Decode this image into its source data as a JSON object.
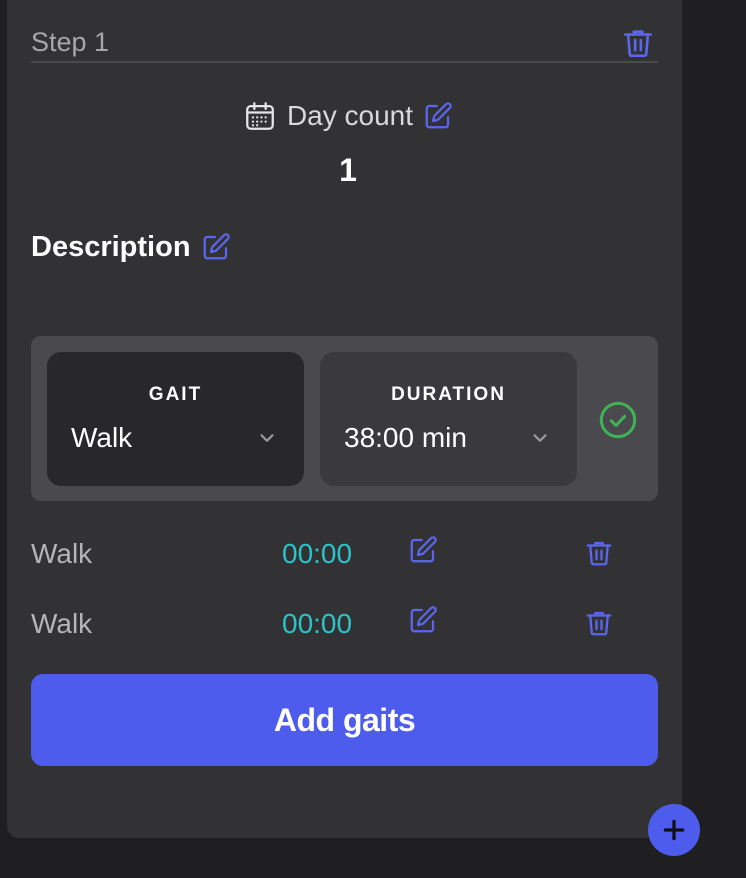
{
  "step": {
    "title": "Step 1"
  },
  "day_count": {
    "label": "Day count",
    "value": "1"
  },
  "description": {
    "label": "Description"
  },
  "selector": {
    "gait_label": "GAIT",
    "gait_value": "Walk",
    "duration_label": "DURATION",
    "duration_value": "38:00 min"
  },
  "gaits": [
    {
      "name": "Walk",
      "time": "00:00"
    },
    {
      "name": "Walk",
      "time": "00:00"
    }
  ],
  "add_button_label": "Add gaits",
  "colors": {
    "accent": "#4e5ced",
    "time_text": "#2bc3c8",
    "confirm": "#3fb356",
    "card_bg": "#323234"
  },
  "icons": [
    "trash-icon",
    "calendar-icon",
    "edit-icon",
    "chevron-down-icon",
    "check-circle-icon",
    "plus-icon"
  ]
}
